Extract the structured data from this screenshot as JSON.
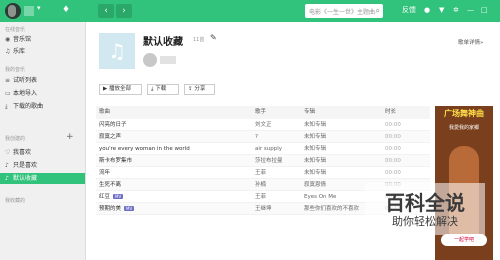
{
  "topbar": {
    "back_icon": "chevron-left",
    "forward_icon": "chevron-right",
    "search_placeholder": "电影《一生一世》主题曲",
    "feedback_label": "反馈"
  },
  "sidebar": {
    "sections": {
      "online": "在线音乐",
      "mine": "我的音乐",
      "created": "我创建的",
      "collected": "我收藏的"
    },
    "items": [
      {
        "label": "音乐馆",
        "icon": "music-hall-icon"
      },
      {
        "label": "乐库",
        "icon": "library-icon"
      },
      {
        "label": "试听列表",
        "icon": "list-icon"
      },
      {
        "label": "本地导入",
        "icon": "import-icon"
      },
      {
        "label": "下载的歌曲",
        "icon": "download-icon"
      },
      {
        "label": "我喜欢",
        "icon": "heart-icon"
      },
      {
        "label": "只是喜欢",
        "icon": "note-icon"
      },
      {
        "label": "默认收藏",
        "icon": "note-icon"
      }
    ],
    "active_color": "#31c27c"
  },
  "playlist": {
    "title": "默认收藏",
    "count": "11首",
    "details_link": "歌单详情»"
  },
  "actions": {
    "play_all": "播放全部",
    "download": "下载",
    "share": "分享"
  },
  "table": {
    "headers": {
      "name": "歌曲",
      "artist": "歌手",
      "album": "专辑",
      "duration": "时长"
    },
    "rows": [
      {
        "name": "闪亮的日子",
        "mv": false,
        "artist": "刘文正",
        "album": "未知专辑",
        "duration": "00:00"
      },
      {
        "name": "寂寞之声",
        "mv": false,
        "artist": "?",
        "album": "未知专辑",
        "duration": "00:00"
      },
      {
        "name": "you're every woman in the world",
        "mv": false,
        "artist": "air supply",
        "album": "未知专辑",
        "duration": "00:00"
      },
      {
        "name": "斯卡布罗集市",
        "mv": false,
        "artist": "莎拉布拉曼",
        "album": "未知专辑",
        "duration": "00:00"
      },
      {
        "name": "流年",
        "mv": false,
        "artist": "王菲",
        "album": "未知专辑",
        "duration": "00:00"
      },
      {
        "name": "生死不离",
        "mv": false,
        "artist": "孙楠",
        "album": "寂寞恩情",
        "duration": "00:00"
      },
      {
        "name": "红豆",
        "mv": true,
        "artist": "王菲",
        "album": "Eyes On Me",
        "duration": "00:00"
      },
      {
        "name": "预期的美",
        "mv": true,
        "artist": "王继坤",
        "album": "那些你们喜欢的不喜欢",
        "duration": "05:13"
      }
    ],
    "mv_label": "MV"
  },
  "ad": {
    "title": "广场舞神曲",
    "subtitle": "我愛我的家鄉",
    "bubble": "一起学吧"
  },
  "watermark": {
    "main": "百科全说",
    "sub": "助你轻松解决"
  }
}
